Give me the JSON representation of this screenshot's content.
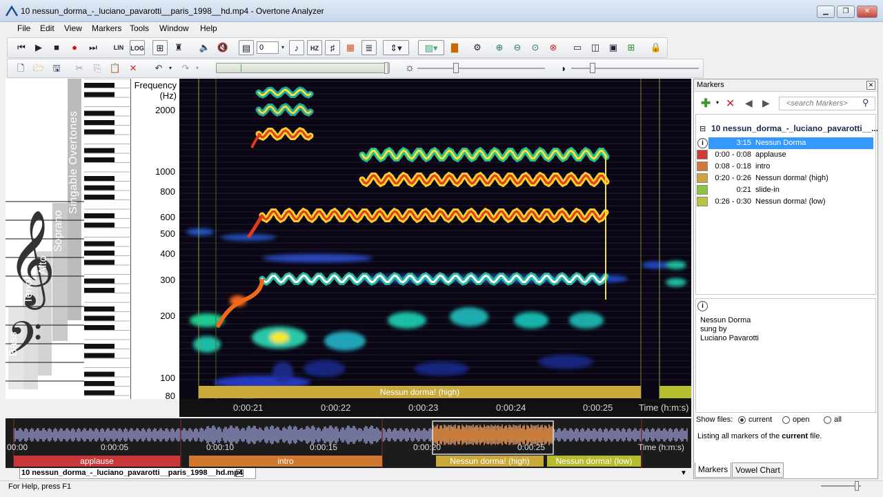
{
  "window": {
    "title": "10 nessun_dorma_-_luciano_pavarotti__paris_1998__hd.mp4 - Overtone Analyzer"
  },
  "menu": [
    "File",
    "Edit",
    "View",
    "Markers",
    "Tools",
    "Window",
    "Help"
  ],
  "toolbar": {
    "lin_label": "LIN",
    "log_label": "LOG",
    "hz_label": "HZ",
    "counter_value": "0"
  },
  "piano_panel": {
    "labels": [
      "Singable Overtones",
      "Soprano",
      "Alto",
      "Tenor",
      "Bass"
    ]
  },
  "frequency_axis": {
    "title_line1": "Frequency",
    "title_line2": "(Hz)",
    "ticks": [
      "2000",
      "1000",
      "800",
      "600",
      "500",
      "400",
      "300",
      "200",
      "100",
      "80"
    ]
  },
  "spectrogram": {
    "marker_bar_label": "Nessun dorma! (high)"
  },
  "time_axis": {
    "ticks": [
      "0:00:21",
      "0:00:22",
      "0:00:23",
      "0:00:24",
      "0:00:25"
    ],
    "unit_label": "Time (h:m:s)"
  },
  "overview": {
    "ticks": [
      "00:00",
      "0:00:05",
      "0:00:10",
      "0:00:15",
      "0:00:20",
      "0:00:25"
    ],
    "unit_label": "Time (h:m:s)",
    "segments": [
      {
        "label": "applause",
        "color": "#c8383a"
      },
      {
        "label": "intro",
        "color": "#d0782f"
      },
      {
        "label": "Nessun dorma! (high)",
        "color": "#c9a93a"
      },
      {
        "label": "Nessun dorma! (low)",
        "color": "#b5bd2e"
      }
    ]
  },
  "doc_tab": {
    "label": "10 nessun_dorma_-_luciano_pavarotti__paris_1998__hd.mp4"
  },
  "status": {
    "text": "For Help, press F1"
  },
  "markers_panel": {
    "title": "Markers",
    "search_placeholder": "<search Markers>",
    "file_group": "10 nessun_dorma_-_luciano_pavarotti__...",
    "items": [
      {
        "time": "3:15",
        "label": "Nessun Dorma",
        "color": "#ffffff",
        "selected": true
      },
      {
        "time": "0:00 - 0:08",
        "label": "applause",
        "color": "#d23a3a"
      },
      {
        "time": "0:08 - 0:18",
        "label": "intro",
        "color": "#d07a36"
      },
      {
        "time": "0:20 - 0:26",
        "label": "Nessun dorma! (high)",
        "color": "#cfa53c"
      },
      {
        "time": "0:21",
        "label": "slide-in",
        "color": "#8ec43a"
      },
      {
        "time": "0:26 - 0:30",
        "label": "Nessun dorma! (low)",
        "color": "#b9c43a"
      }
    ],
    "info_lines": [
      "Nessun Dorma",
      "sung by",
      "Luciano Pavarotti"
    ],
    "show_files_label": "Show files:",
    "show_files_options": [
      "current",
      "open",
      "all"
    ],
    "listing_prefix": "Listing all markers of the ",
    "listing_bold": "current",
    "listing_suffix": " file.",
    "tabs": [
      "Markers",
      "Vowel Chart"
    ]
  }
}
